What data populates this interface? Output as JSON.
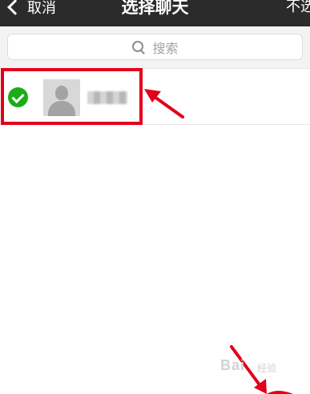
{
  "header": {
    "back_label": "取消",
    "title": "选择聊天",
    "right_action": "不选"
  },
  "search": {
    "placeholder": "搜索"
  },
  "contacts": [
    {
      "selected": true,
      "name_blurred": true
    }
  ],
  "watermark": {
    "brand": "Bai",
    "suffix": "经验"
  },
  "colors": {
    "header_bg": "#2b2b2b",
    "check_green": "#1aad19",
    "annotation_red": "#e2001a"
  }
}
